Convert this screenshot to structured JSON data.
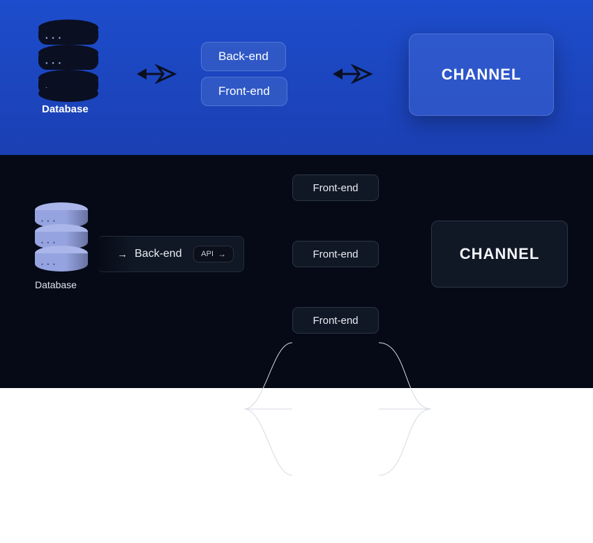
{
  "top": {
    "database_label": "Database",
    "backend": "Back-end",
    "frontend": "Front-end",
    "channel": "CHANNEL"
  },
  "bottom": {
    "database_label": "Database",
    "backend": "Back-end",
    "api_label": "API",
    "frontends": [
      "Front-end",
      "Front-end",
      "Front-end"
    ],
    "channel": "CHANNEL"
  }
}
